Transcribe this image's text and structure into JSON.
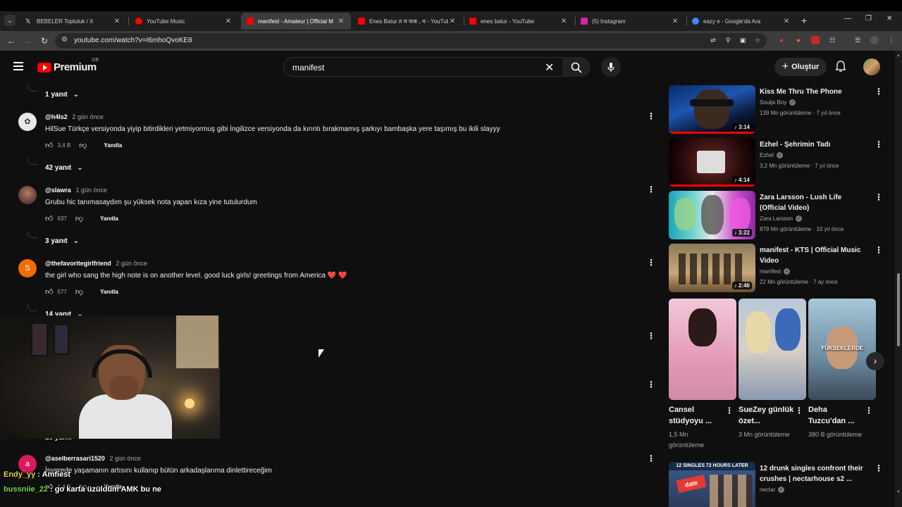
{
  "browser": {
    "tabs": [
      {
        "label": "BEBELER Topluluk / X",
        "favicon_color": "#000000",
        "active": false
      },
      {
        "label": "YouTube Music",
        "favicon_color": "#ff0000",
        "active": false
      },
      {
        "label": "manifest - Amateur | Official M",
        "favicon_color": "#ff0000",
        "active": true
      },
      {
        "label": "Enes Batur त थ फक , थ - YouTube",
        "favicon_color": "#ff0000",
        "active": false
      },
      {
        "label": "enes batur - YouTube",
        "favicon_color": "#ff0000",
        "active": false
      },
      {
        "label": "(5) Instagram",
        "favicon_color": "#d6249f",
        "active": false
      },
      {
        "label": "eazy e - Google'da Ara",
        "favicon_color": "#4285f4",
        "active": false
      }
    ],
    "url": "youtube.com/watch?v=I6mhoQvoKE8"
  },
  "header": {
    "brand": "Premium",
    "region": "GB",
    "search_value": "manifest",
    "create_label": "Oluştur"
  },
  "comments": {
    "toggles": [
      "1 yanıt",
      "42 yanıt",
      "3 yanıt",
      "14 yanıt",
      "16 yanıt"
    ],
    "items": [
      {
        "handle": "@h4ls2",
        "when": "2 gün önce",
        "text": "HilSue Türkçe versiyonda yiyip bitirdikleri yetmiyormuş gibi İngilizce versiyonda da kırıntı bırakmamış şarkıyı bambaşka yere taşımış bu ikili slayyy",
        "likes": "3,4 B",
        "reply": "Yanıtla"
      },
      {
        "handle": "@slawra",
        "when": "1 gün önce",
        "text": "Grubu hic tanımasaydım şu yüksek nota yapan kıza yine tutulurdum",
        "likes": "637",
        "reply": "Yanıtla"
      },
      {
        "handle": "@thefavoritegirlfriend",
        "when": "2 gün önce",
        "text": "the girl who sang the high note is on another level. good luck girls! greetings from America ❤️ ❤️",
        "likes": "577",
        "reply": "Yanıtla",
        "avatar_letter": "S"
      },
      {
        "handle": "@aselberrasari1520",
        "when": "2 gün önce",
        "text": "İşyerede yaşamanın artısını kullanıp bütün arkadaşlarıma dinlettireceğim",
        "likes": "1,4 B",
        "reply": "Yanıtla",
        "avatar_letter": "a"
      }
    ]
  },
  "chat": [
    {
      "user": "Endy_yy",
      "message": "Amfiest"
    },
    {
      "user": "bussniie_22",
      "message": "go karta üzüldüm AMK bu ne"
    }
  ],
  "sidebar": {
    "videos": [
      {
        "title": "Kiss Me Thru The Phone",
        "channel": "Soulja Boy",
        "meta": "139 Mn görüntüleme · 7 yıl önce",
        "duration": "♪ 3:14"
      },
      {
        "title": "Ezhel - Şehrimin Tadı",
        "channel": "Ezhel",
        "meta": "3,2 Mn görüntüleme · 7 yıl önce",
        "duration": "♪ 4:14"
      },
      {
        "title": "Zara Larsson - Lush Life (Official Video)",
        "channel": "Zara Larsson",
        "meta": "879 Mn görüntüleme · 10 yıl önce",
        "duration": "♪ 3:22"
      },
      {
        "title": "manifest - KTS | Official Music Video",
        "channel": "manifest",
        "meta": "22 Mn görüntüleme · 7 ay önce",
        "duration": "♪ 2:46"
      },
      {
        "title": "12 drunk singles confront their crushes | nectarhouse s2 ...",
        "channel": "nectar",
        "meta": "",
        "duration": ""
      }
    ],
    "shorts": [
      {
        "title": "Cansel stüdyoyu ...",
        "views": "1,5 Mn görüntüleme",
        "overlay": ""
      },
      {
        "title": "SueZey günlük özet...",
        "views": "3 Mn görüntüleme",
        "overlay": ""
      },
      {
        "title": "Deha Tuzcu'dan ...",
        "views": "380 B görüntüleme",
        "overlay": "YÜKSEKLERDE"
      }
    ],
    "thumb_texts": [
      "12 SINGLES 72 HOURS LATER",
      "date"
    ]
  },
  "icons": [
    "hamburger-icon",
    "youtube-logo-icon",
    "search-icon",
    "mic-icon",
    "bell-icon",
    "like-icon",
    "dislike-icon",
    "more-icon",
    "verified-icon",
    "chevron-down-icon",
    "chevron-right-icon"
  ]
}
